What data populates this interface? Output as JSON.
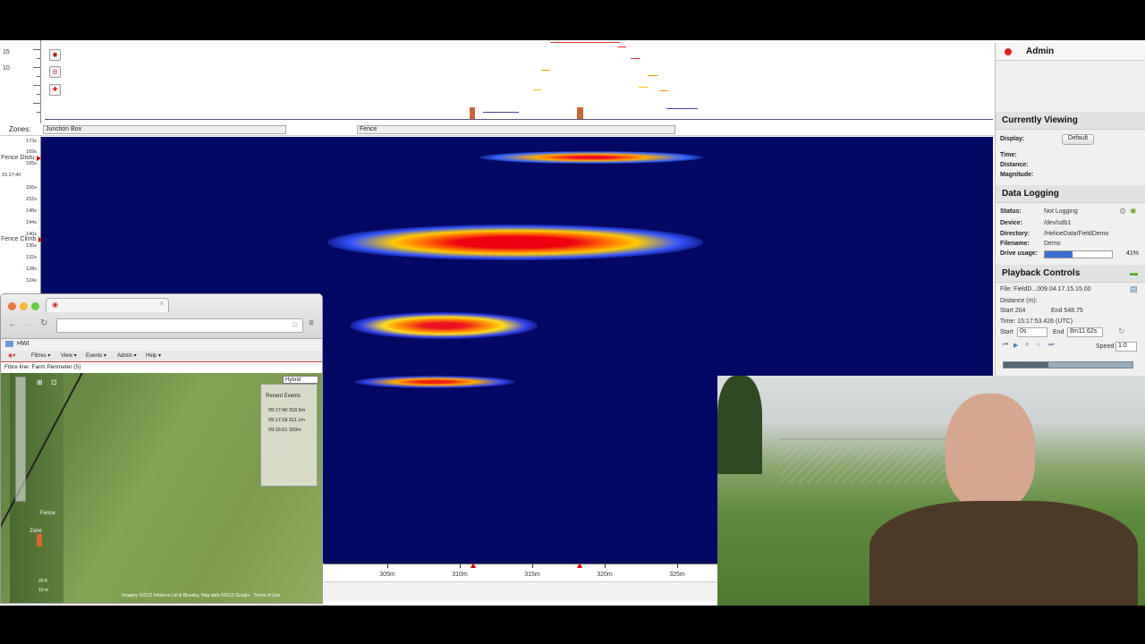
{
  "trace": {
    "ruler_labels": [
      "15",
      "10"
    ],
    "zoom_buttons": [
      "zoom-in",
      "zoom-out",
      "add-marker"
    ]
  },
  "zones": {
    "label": "Zones:",
    "items": [
      "Junction Box",
      "Fence"
    ]
  },
  "waterfall": {
    "y_ticks": [
      "173s",
      "169s",
      "165s",
      "15:17:40",
      "156s",
      "152s",
      "148s",
      "144s",
      "140s",
      "136s",
      "132s",
      "128s",
      "124s"
    ],
    "alarms": [
      "Fence Distu",
      "Fence Climb"
    ],
    "x_ticks": [
      "305m",
      "310m",
      "315m",
      "320m",
      "325m"
    ]
  },
  "right_panel": {
    "user": "Admin",
    "currently_viewing": {
      "title": "Currently Viewing",
      "display_label": "Display:",
      "display_value": "Default",
      "time_label": "Time:",
      "distance_label": "Distance:",
      "magnitude_label": "Magnitude:"
    },
    "data_logging": {
      "title": "Data Logging",
      "status_label": "Status:",
      "status_value": "Not Logging",
      "device_label": "Device:",
      "device_value": "/dev/sdb1",
      "directory_label": "Directory:",
      "directory_value": "/HelioeData/FieldDemo",
      "filename_label": "Filename:",
      "filename_value": "Demo",
      "drive_label": "Drive usage:",
      "drive_value": "41%",
      "drive_fraction": 0.41
    },
    "playback": {
      "title": "Playback Controls",
      "file": "File: FieldD...009.04.17.15.15.00",
      "distance_label": "Distance (m):",
      "start_dist": "Start 204",
      "end_dist": "End 548.75",
      "time": "Time: 15:17:53.426 (UTC)",
      "start_label": "Start",
      "start_value": "0s",
      "end_label": "End",
      "end_value": "8m11.62s",
      "speed_label": "Speed",
      "speed_value": "1.0"
    }
  },
  "browser": {
    "bookmark": "HWI",
    "menus": [
      "Fibres ▾",
      "View ▾",
      "Events ▾",
      "Admin ▾",
      "Help ▾"
    ],
    "fibre_line": "Fibre line: Farm Perimeter (5)",
    "map_type": "Hybrid",
    "recent_events_title": "Recent Events",
    "events": [
      "09:17:40 318.5m",
      "09:17:18 311.1m",
      "09:16:51 309m"
    ],
    "map_labels": [
      "Fence",
      "Zone"
    ],
    "scale": [
      "20 ft",
      "10 m"
    ],
    "credit": "Imagery ©2012 Infoterra Ltd & Bluesky, Map data ©2012 Google - Terms of Use"
  },
  "colors": {
    "waterfall_bg": "#020863",
    "accent": "#3b6fd6",
    "alarm": "#dd0000"
  }
}
